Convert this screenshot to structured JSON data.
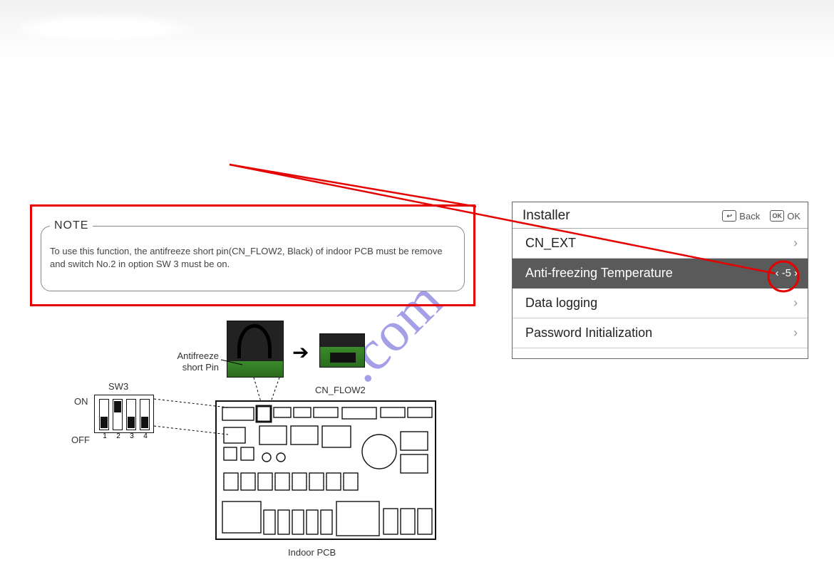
{
  "note": {
    "title": "NOTE",
    "body": "To use this function, the antifreeze short pin(CN_FLOW2, Black) of indoor PCB must be remove and switch No.2 in option SW 3 must be on."
  },
  "installer": {
    "title": "Installer",
    "back_label": "Back",
    "ok_label": "OK",
    "back_icon": "↩",
    "ok_icon": "OK",
    "items": [
      {
        "label": "CN_EXT",
        "value": "",
        "selected": false
      },
      {
        "label": "Anti-freezing Temperature",
        "value": "-5",
        "selected": true
      },
      {
        "label": "Data logging",
        "value": "",
        "selected": false
      },
      {
        "label": "Password Initialization",
        "value": "",
        "selected": false
      }
    ]
  },
  "diagram": {
    "antifreeze_pin_label": "Antifreeze short Pin",
    "cn_flow2_label": "CN_FLOW2",
    "sw3_label": "SW3",
    "on_label": "ON",
    "off_label": "OFF",
    "pcb_label": "Indoor PCB",
    "dip_numbers": [
      "1",
      "2",
      "3",
      "4"
    ]
  },
  "watermark": ".com"
}
